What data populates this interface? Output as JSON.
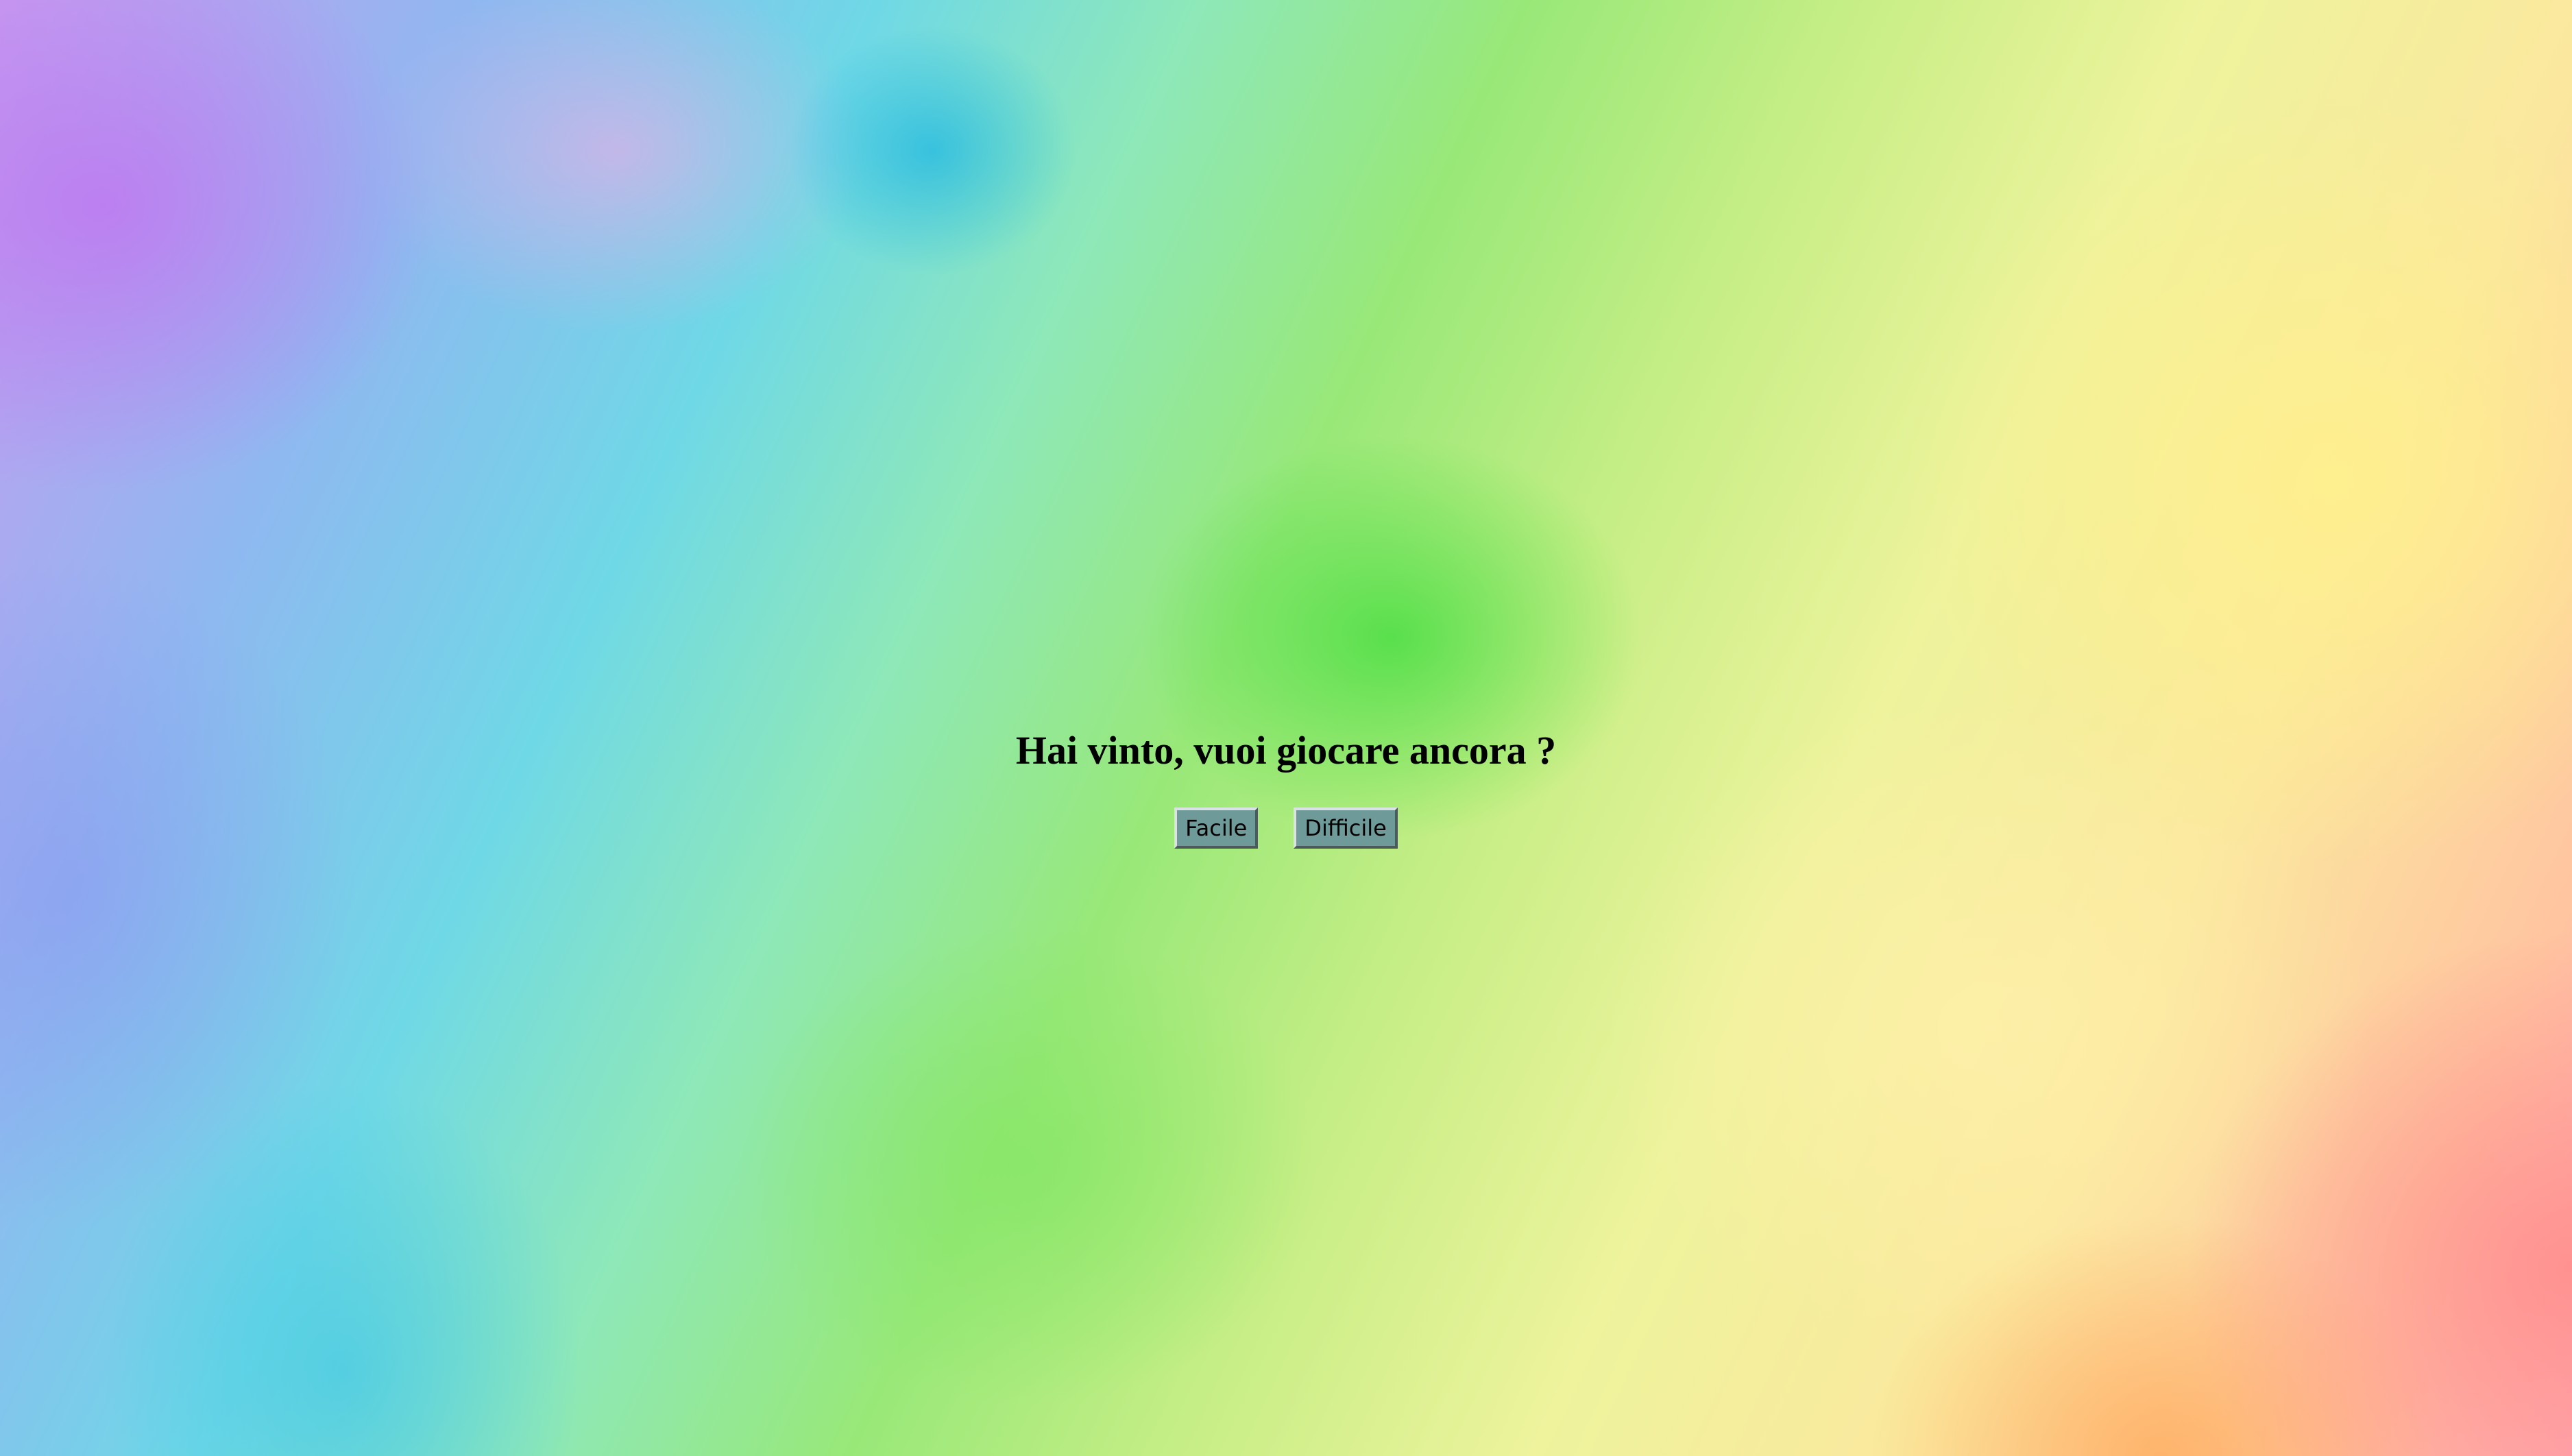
{
  "message": {
    "title": "Hai vinto, vuoi giocare ancora ?"
  },
  "buttons": {
    "easy_label": "Facile",
    "hard_label": "Difficile"
  },
  "colors": {
    "button_background": "#6f9a9a",
    "text": "#000000"
  }
}
